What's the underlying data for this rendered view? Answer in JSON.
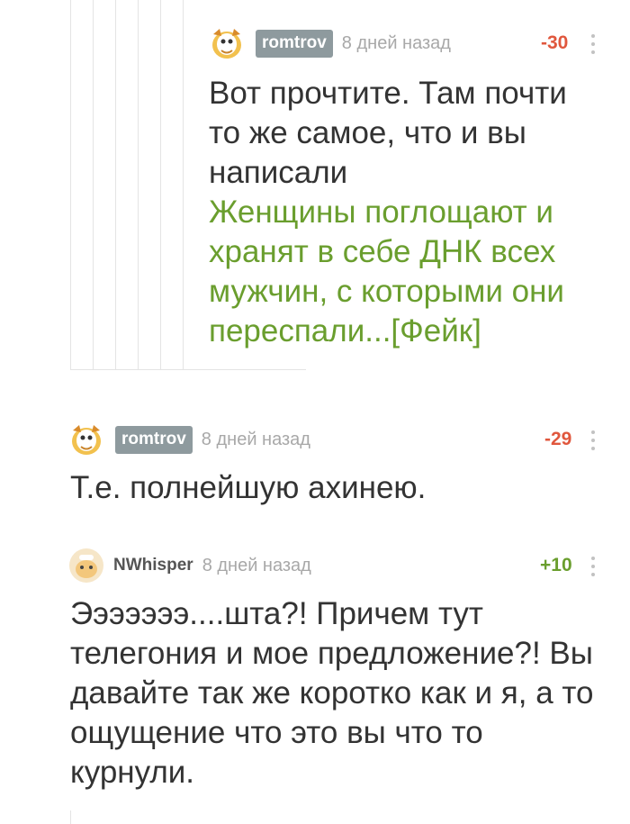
{
  "comments": [
    {
      "author": "romtrov",
      "date": "8 дней назад",
      "rating": "-30",
      "text": "Вот прочтите. Там почти то же самое, что и вы написали",
      "link_text": "Женщины поглощают и хранят в себе ДНК всех мужчин, с которыми они переспали...[Фейк]"
    },
    {
      "author": "romtrov",
      "date": "8 дней назад",
      "rating": "-29",
      "text": "Т.е. полнейшую ахинею."
    },
    {
      "author": "NWhisper",
      "date": "8 дней назад",
      "rating": "+10",
      "text": "Эээээээ....шта?! Причем тут телегония и мое предложение?! Вы давайте так же коротко как и я, а то ощущение что это вы что то курнули."
    }
  ],
  "colors": {
    "negative_rating": "#e0573d",
    "positive_rating": "#6a9e2e",
    "link": "#6a9e2e",
    "nick_badge": "#8e9a9e"
  },
  "icons": [
    "more-options-icon",
    "avatar"
  ]
}
